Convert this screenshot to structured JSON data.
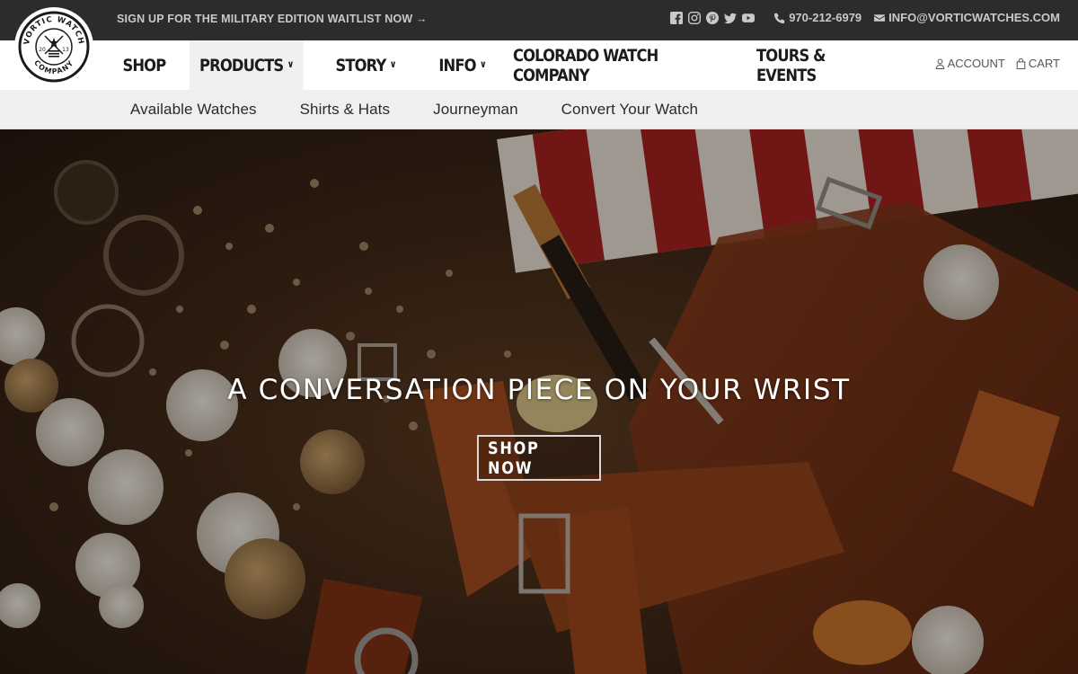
{
  "topbar": {
    "announcement": "SIGN UP FOR THE MILITARY EDITION WAITLIST NOW →",
    "social_icons": [
      "facebook-icon",
      "instagram-icon",
      "pinterest-icon",
      "twitter-icon",
      "youtube-icon"
    ],
    "phone": "970-212-6979",
    "email": "INFO@VORTICWATCHES.COM"
  },
  "logo": {
    "text_top": "VORTIC WATCH",
    "text_bottom": "COMPANY",
    "year_left": "20",
    "year_right": "13"
  },
  "nav": {
    "items": [
      {
        "label": "SHOP",
        "has_dropdown": false
      },
      {
        "label": "PRODUCTS",
        "has_dropdown": true
      },
      {
        "label": "STORY",
        "has_dropdown": true
      },
      {
        "label": "INFO",
        "has_dropdown": true
      },
      {
        "label": "COLORADO WATCH COMPANY",
        "has_dropdown": false
      },
      {
        "label": "TOURS & EVENTS",
        "has_dropdown": false
      }
    ],
    "account": "ACCOUNT",
    "cart": "CART"
  },
  "subnav": {
    "items": [
      {
        "label": "Available Watches"
      },
      {
        "label": "Shirts & Hats"
      },
      {
        "label": "Journeyman"
      },
      {
        "label": "Convert Your Watch"
      }
    ]
  },
  "hero": {
    "title": "A CONVERSATION PIECE ON YOUR WRIST",
    "button": "SHOP NOW"
  },
  "colors": {
    "topbar_bg": "#2c2c2e",
    "nav_active_bg": "#f0f0f0",
    "subnav_bg": "#efefef"
  }
}
